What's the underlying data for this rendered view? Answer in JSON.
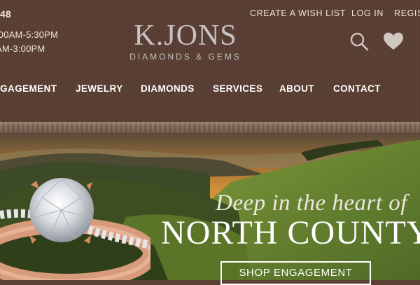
{
  "topbar": {
    "phone_fragment": "48",
    "hours_line_1": ":00AM-5:30PM",
    "hours_line_2": "AM-3:00PM"
  },
  "utility_links": {
    "create_wish_list": "CREATE A WISH LIST",
    "log_in": "LOG IN",
    "register": "REGIS"
  },
  "logo": {
    "main": "K.JONS",
    "sub": "DIAMONDS & GEMS"
  },
  "icons": {
    "search": "search-icon",
    "wishlist": "heart-icon"
  },
  "nav": [
    {
      "label": "NGAGEMENT"
    },
    {
      "label": "JEWELRY"
    },
    {
      "label": "DIAMONDS"
    },
    {
      "label": "SERVICES"
    },
    {
      "label": "ABOUT"
    },
    {
      "label": "CONTACT"
    }
  ],
  "hero": {
    "tagline": "Deep in the heart of",
    "headline": "NORTH COUNTY",
    "cta_label": "SHOP ENGAGEMENT"
  },
  "colors": {
    "header_bg": "#5b4034",
    "logo": "#c6c2c1",
    "text": "#ffffff"
  }
}
